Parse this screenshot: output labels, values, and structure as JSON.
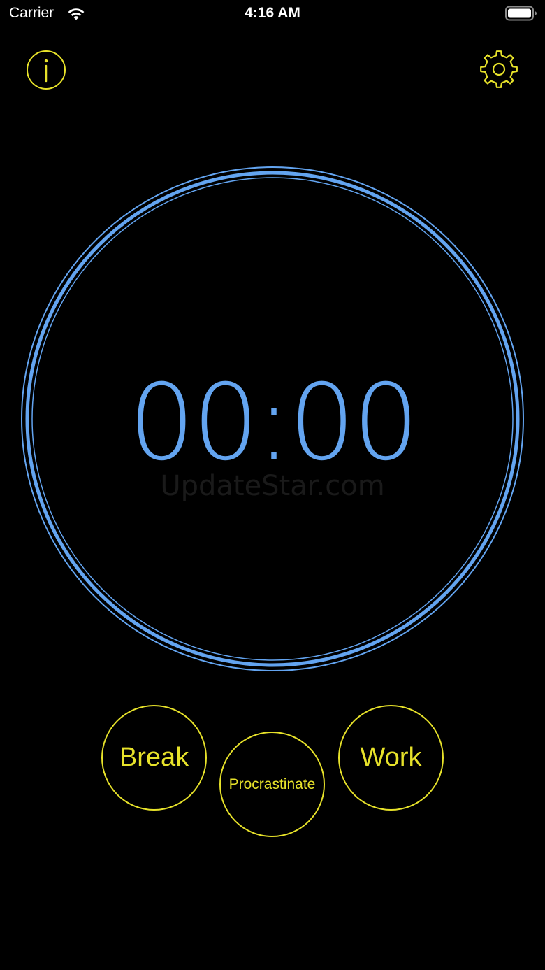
{
  "status_bar": {
    "carrier": "Carrier",
    "time": "4:16 AM"
  },
  "header": {
    "info_icon": "info-icon",
    "settings_icon": "gear-icon"
  },
  "timer": {
    "display": "00:00",
    "watermark": "UpdateStar.com"
  },
  "modes": {
    "break_label": "Break",
    "procrastinate_label": "Procrastinate",
    "work_label": "Work"
  },
  "colors": {
    "background": "#000000",
    "accent_yellow": "#e7e22a",
    "timer_blue": "#63a4f0"
  }
}
